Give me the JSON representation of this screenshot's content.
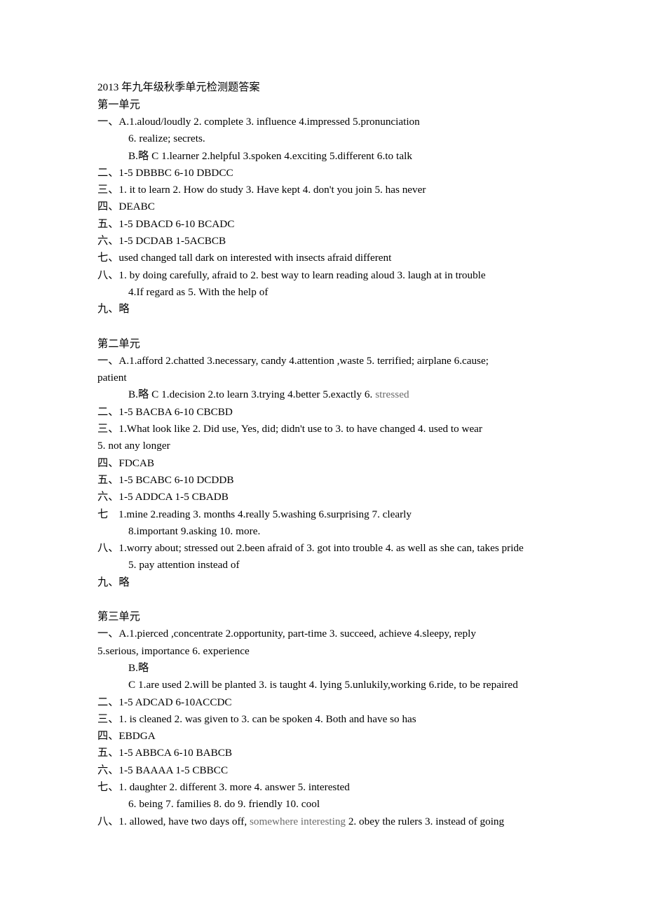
{
  "document": {
    "title": "2013 年九年级秋季单元检测题答案",
    "units": [
      {
        "heading": "第一单元",
        "lines": [
          {
            "marker": "一、",
            "text": "A.1.aloud/loudly 2. complete    3. influence 4.impressed 5.pronunciation"
          },
          {
            "marker": "",
            "indent": 1,
            "text": "6. realize; secrets."
          },
          {
            "marker": "",
            "indent": 1,
            "text": "B.略  C 1.learner 2.helpful 3.spoken 4.exciting 5.different 6.to talk"
          },
          {
            "marker": "二、",
            "text": "1-5 DBBBC          6-10 DBDCC"
          },
          {
            "marker": "三、",
            "text": "1. it to learn   2. How do study   3. Have kept   4. don't you join   5. has never"
          },
          {
            "marker": "四、",
            "text": "DEABC"
          },
          {
            "marker": "五、",
            "text": "1-5   DBACD            6-10   BCADC"
          },
          {
            "marker": "六、",
            "text": "1-5   DCDAB           1-5ACBCB"
          },
          {
            "marker": "七、",
            "text": "used   changed   tall   dark   on   interested   with   insects   afraid   different"
          },
          {
            "marker": "八、",
            "text": "1. by doing carefully, afraid to      2. best way to learn reading aloud      3. laugh at in trouble"
          },
          {
            "marker": "",
            "indent": 1,
            "text": "4.If regard as               5. With the help of"
          },
          {
            "marker": "九、",
            "text": "略"
          }
        ]
      },
      {
        "heading": "第二单元",
        "lines": [
          {
            "marker": "一、",
            "text": "A.1.afford 2.chatted    3.necessary, candy 4.attention ,waste    5. terrified; airplane 6.cause;"
          },
          {
            "marker": "",
            "indent": 0,
            "text": "patient"
          },
          {
            "marker": "",
            "indent": 1,
            "text": "B.略  C 1.decision 2.to learn 3.trying 4.better 5.exactly 6. ",
            "faded_tail": "stressed"
          },
          {
            "marker": "二、",
            "text": "1-5 BACBA        6-10 CBCBD"
          },
          {
            "marker": "三、",
            "text": "1.What look like   2. Did use, Yes, did; didn't use to   3. to have changed   4. used to wear"
          },
          {
            "marker": "",
            "indent": 0,
            "text": "5. not any longer"
          },
          {
            "marker": "四、",
            "text": "FDCAB"
          },
          {
            "marker": "五、",
            "text": "1-5 BCABC                   6-10 DCDDB"
          },
          {
            "marker": "六、",
            "text": "1-5 ADDCA                1-5 CBADB"
          },
          {
            "marker": "七",
            "text": "1.mine   2.reading   3. months   4.really 5.washing 6.surprising 7. clearly"
          },
          {
            "marker": "",
            "indent": 1,
            "text": "8.important   9.asking   10. more."
          },
          {
            "marker": "八、",
            "text": "1.worry about; stressed out 2.been afraid of 3. got into trouble 4. as well as she can, takes pride"
          },
          {
            "marker": "",
            "indent": 1,
            "text": "5. pay attention instead of"
          },
          {
            "marker": "九、",
            "text": "略"
          }
        ]
      },
      {
        "heading": "第三单元",
        "lines": [
          {
            "marker": "一、",
            "text": "A.1.pierced ,concentrate 2.opportunity, part-time 3. succeed, achieve    4.sleepy, reply"
          },
          {
            "marker": "",
            "indent": 0,
            "text": " 5.serious, importance    6. experience"
          },
          {
            "marker": "",
            "indent": 1,
            "text": "B.略"
          },
          {
            "marker": "",
            "indent": 1,
            "text": "C 1.are used 2.will be planted 3. is taught 4. lying 5.unlukily,working    6.ride, to be repaired"
          },
          {
            "marker": "二、",
            "text": "1-5 ADCAD        6-10ACCDC"
          },
          {
            "marker": "三、",
            "text": "1. is cleaned   2. was given to   3. can be spoken   4. Both and have so has"
          },
          {
            "marker": "四、",
            "text": "EBDGA"
          },
          {
            "marker": "五、",
            "text": "1-5 ABBCA                  6-10 BABCB"
          },
          {
            "marker": "六、",
            "text": "1-5 BAAAA                 1-5 CBBCC"
          },
          {
            "marker": "七、",
            "text": "1. daughter   2. different   3. more   4. answer   5. interested"
          },
          {
            "marker": "",
            "indent": 1,
            "text": "6. being      7. families     8. do       9. friendly     10. cool"
          },
          {
            "marker": "八、",
            "text": "1. allowed, have two days off, ",
            "faded_mid": "somewhere interesting",
            "text_tail": "   2. obey the rulers   3. instead of going"
          }
        ]
      }
    ]
  },
  "colors": {
    "page_background": "#ffffff",
    "text": "#000000",
    "faded_text": "#6b6b6b"
  }
}
